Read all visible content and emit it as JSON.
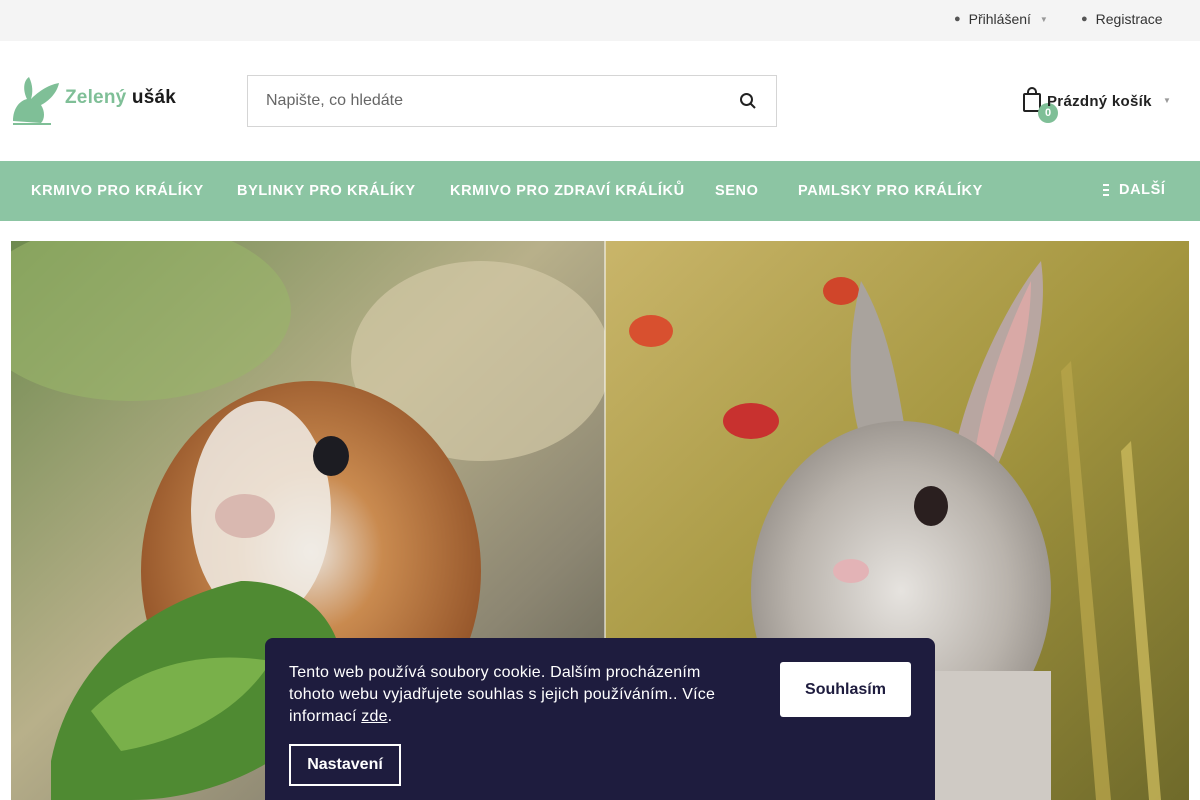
{
  "topbar": {
    "login_label": "Přihlášení",
    "register_label": "Registrace"
  },
  "logo": {
    "word1": "Zelený",
    "word2": "ušák"
  },
  "search": {
    "placeholder": "Napište, co hledáte"
  },
  "cart": {
    "count": "0",
    "label": "Prázdný košík"
  },
  "nav": {
    "items": [
      {
        "label": "KRMIVO PRO KRÁLÍKY"
      },
      {
        "label": "BYLINKY PRO KRÁLÍKY"
      },
      {
        "label": "KRMIVO PRO ZDRAVÍ KRÁLÍKŮ"
      },
      {
        "label": "SENO"
      },
      {
        "label": "PAMLSKY PRO KRÁLÍKY"
      }
    ],
    "more_label": "DALŠÍ"
  },
  "cookie": {
    "text": "Tento web používá soubory cookie. Dalším procházením tohoto webu vyjadřujete souhlas s jejich používáním.. Více informací",
    "link_label": "zde",
    "after_link": ".",
    "agree_label": "Souhlasím",
    "settings_label": "Nastavení"
  },
  "colors": {
    "brand_green": "#8cc5a3",
    "logo_green": "#7fbf97",
    "cookie_bg": "#1e1c3e"
  },
  "icons": {
    "login": "user-icon",
    "register": "user-plus-icon",
    "search": "search-icon",
    "cart": "shopping-bag-icon",
    "more": "menu-icon"
  }
}
